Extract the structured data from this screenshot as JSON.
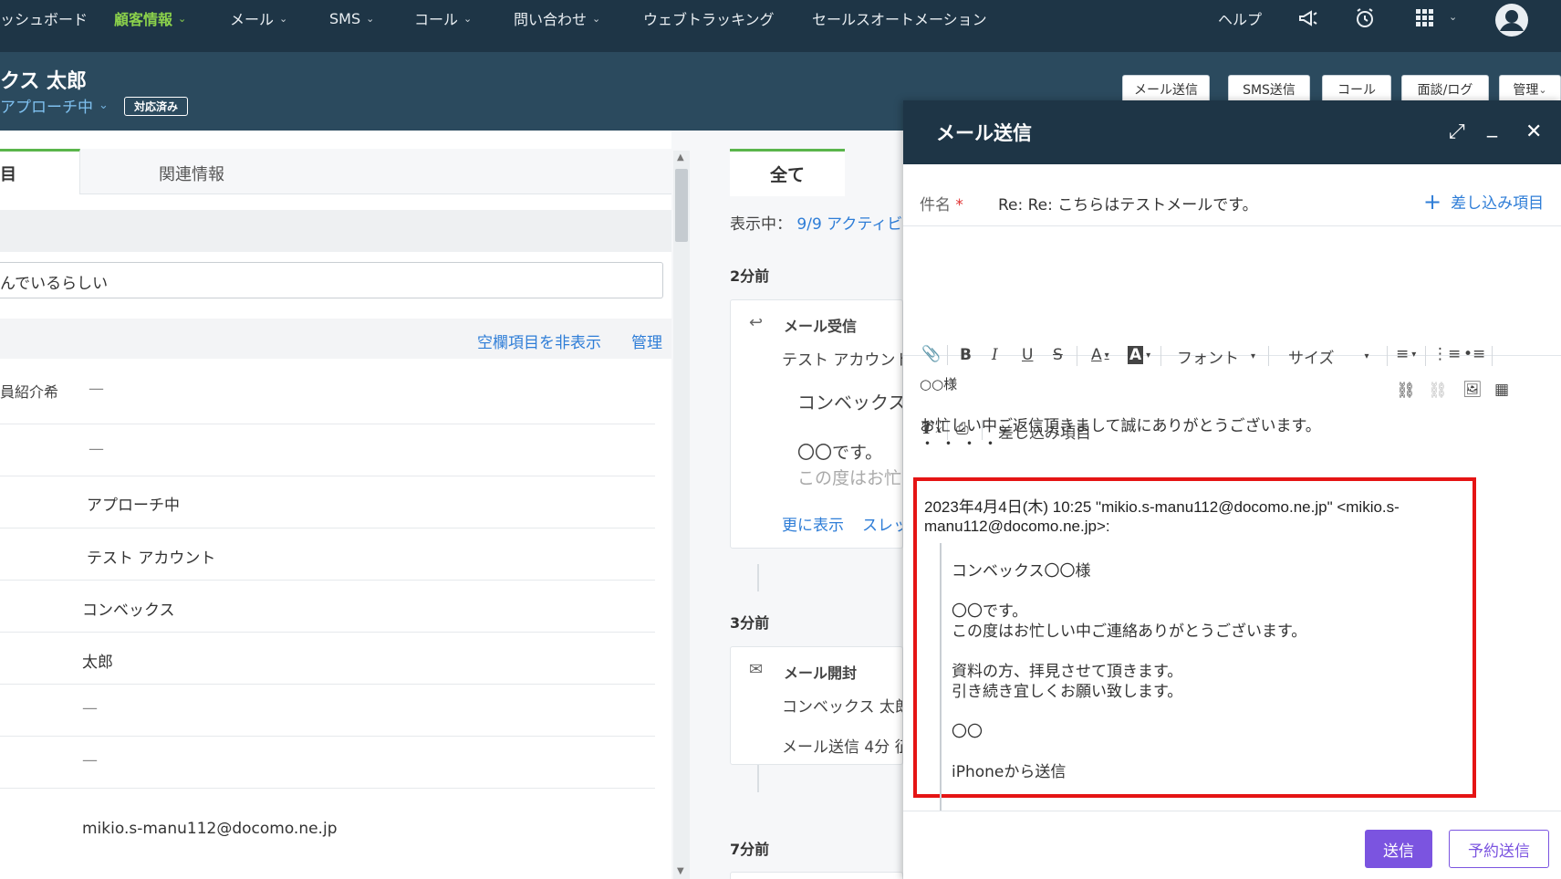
{
  "nav": {
    "items": [
      {
        "label": "ッシュボード",
        "chevron": false
      },
      {
        "label": "顧客情報",
        "chevron": true,
        "active": true
      },
      {
        "label": "メール",
        "chevron": true
      },
      {
        "label": "SMS",
        "chevron": true
      },
      {
        "label": "コール",
        "chevron": true
      },
      {
        "label": "問い合わせ",
        "chevron": true
      },
      {
        "label": "ウェブトラッキング",
        "chevron": false
      },
      {
        "label": "セールスオートメーション",
        "chevron": false
      }
    ],
    "help": "ヘルプ",
    "icons": [
      "megaphone-icon",
      "alarm-clock-icon",
      "apps-grid-icon",
      "avatar-icon"
    ]
  },
  "record": {
    "name": "クス 太郎",
    "status": "アプローチ中",
    "badge": "対応済み",
    "buttons": [
      "メール送信",
      "SMS送信",
      "コール",
      "面談/ログ",
      "管理"
    ]
  },
  "left": {
    "tab_active": "目",
    "tab_related": "関連情報",
    "textarea_value": "んでいるらしい",
    "hide_empty": "空欄項目を非表示",
    "manage": "管理",
    "fields": [
      {
        "label": "員紹介希",
        "value": "—"
      },
      {
        "label": "",
        "value": "—"
      },
      {
        "label": "",
        "value": "アプローチ中"
      },
      {
        "label": "",
        "value": "テスト アカウント"
      },
      {
        "label": "",
        "value": "コンベックス"
      },
      {
        "label": "",
        "value": "太郎"
      },
      {
        "label": "",
        "value": "—"
      },
      {
        "label": "",
        "value": "—"
      },
      {
        "label": "",
        "value": "mikio.s-manu112@docomo.ne.jp"
      }
    ]
  },
  "timeline": {
    "tab": "全て",
    "showing_label": "表示中：",
    "showing_value": "9/9 アクティビ",
    "groups": [
      {
        "time": "2分前",
        "title": "メール受信",
        "lines": [
          "テスト アカウント",
          "コンベックス",
          "〇〇です。",
          "この度はお忙"
        ],
        "links": [
          "更に表示",
          "スレッ"
        ]
      },
      {
        "time": "3分前",
        "title": "メール開封",
        "lines": [
          "コンベックス 太郎",
          "メール送信 4分 征"
        ]
      },
      {
        "time": "7分前"
      }
    ]
  },
  "composer": {
    "title": "メール送信",
    "subject_label": "件名",
    "required_mark": "*",
    "subject_value": "Re: Re: こちらはテストメールです。",
    "merge_fields": "差し込み項目",
    "toolbar": {
      "font": "フォント",
      "size": "サイズ",
      "merge": "差し込み項目"
    },
    "body": {
      "greeting": "○○様",
      "line1": "お忙しい中ご返信頂きまして誠にありがとうございます。",
      "dots": "・・・・"
    },
    "quote": {
      "header": "2023年4月4日(木) 10:25 \"mikio.s-manu112@docomo.ne.jp\" <mikio.s-manu112@docomo.ne.jp>:",
      "lines": [
        "コンベックス〇〇様",
        "",
        "〇〇です。",
        "この度はお忙しい中ご連絡ありがとうございます。",
        "",
        "資料の方、拝見させて頂きます。",
        "引き続き宜しくお願い致します。",
        "",
        "〇〇",
        "",
        "iPhoneから送信"
      ]
    },
    "send": "送信",
    "schedule": "予約送信"
  },
  "colors": {
    "nav_bg": "#1e3546",
    "header_bg": "#2b4a5e",
    "active_green": "#8bd14b",
    "link_blue": "#2e7dd7",
    "send_purple": "#7b54e0",
    "highlight_red": "#e51414"
  }
}
